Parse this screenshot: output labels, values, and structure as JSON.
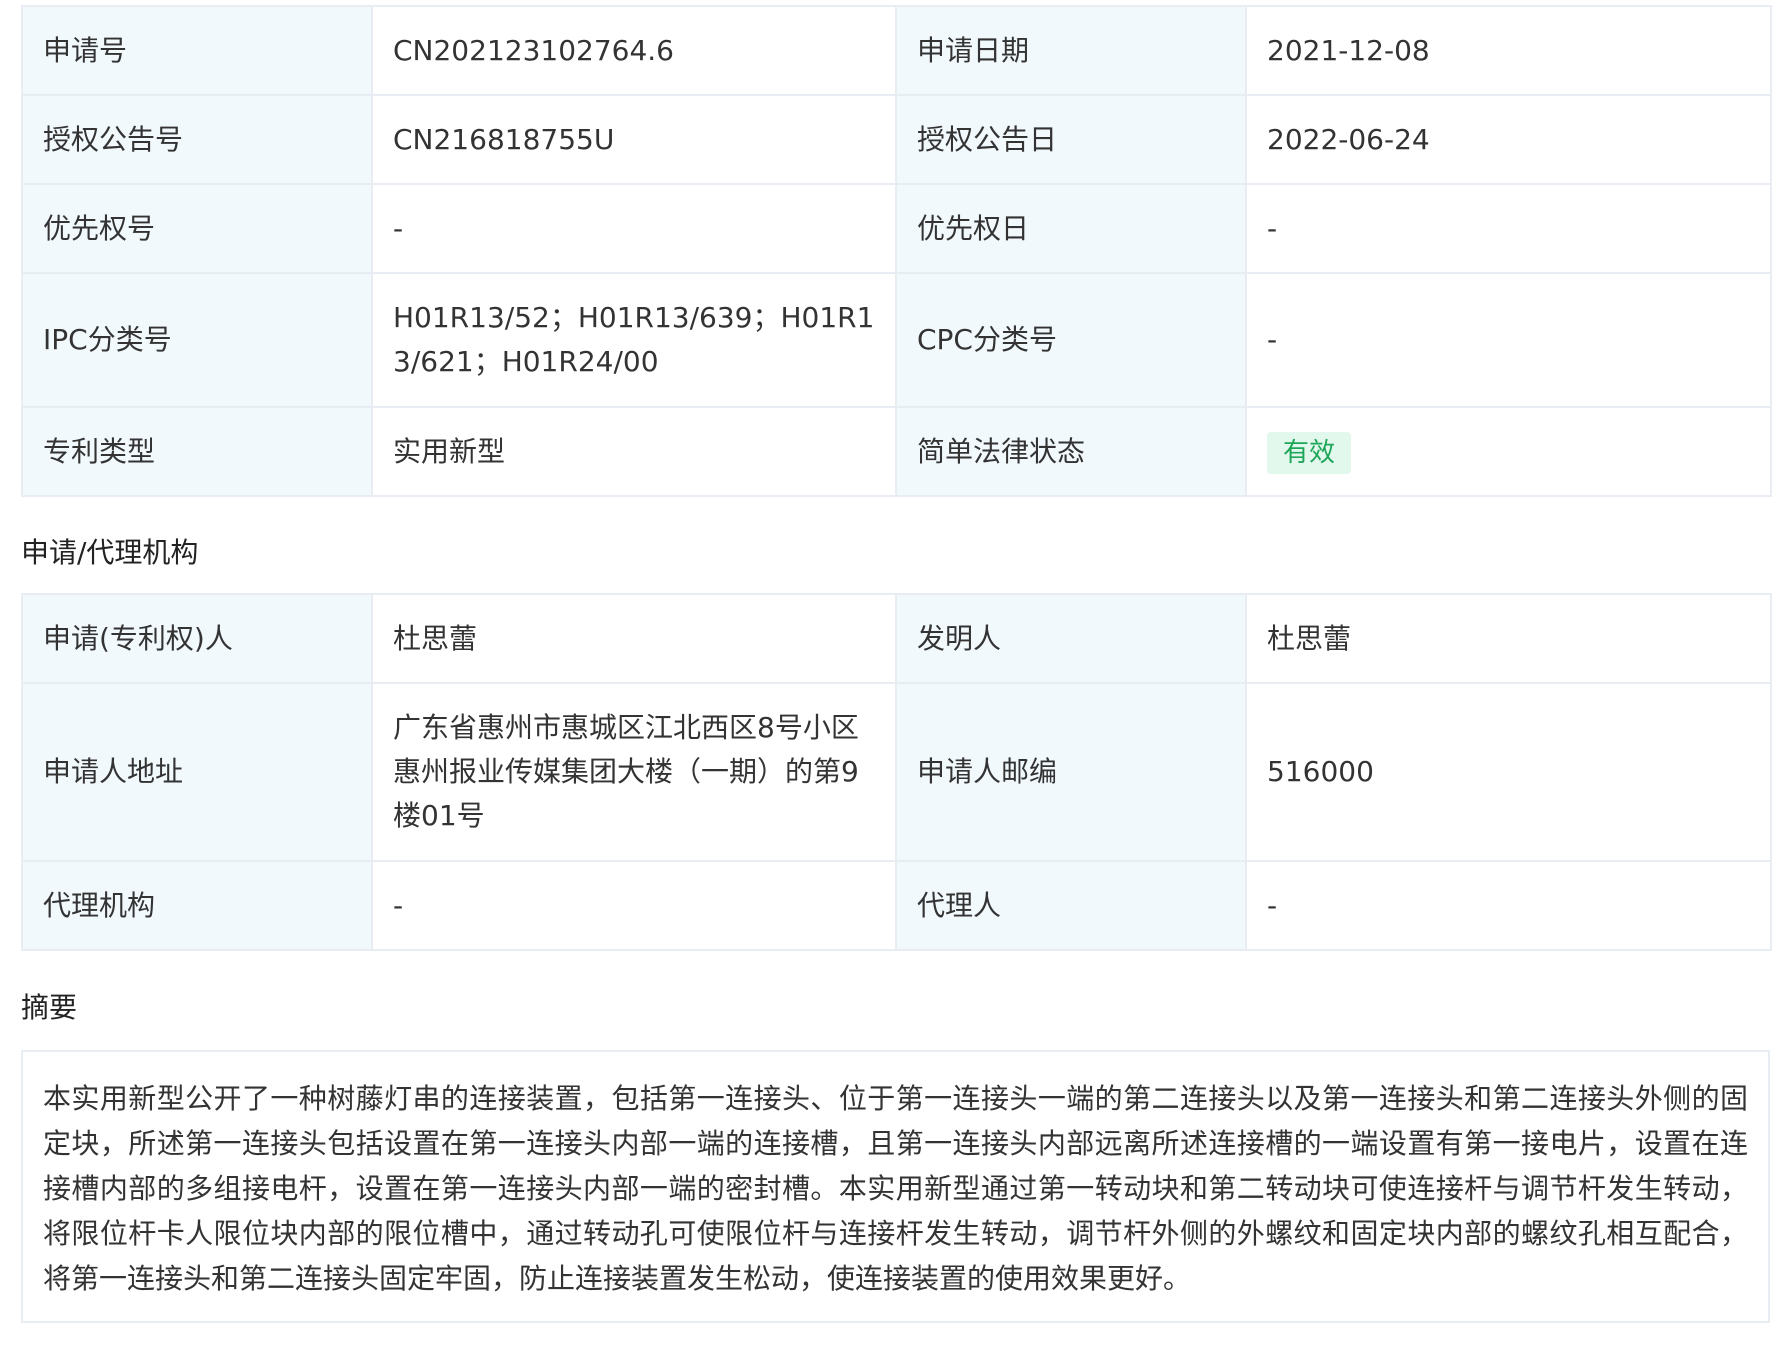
{
  "basic_info": {
    "rows": [
      {
        "k1": "申请号",
        "v1": "CN202123102764.6",
        "k2": "申请日期",
        "v2": "2021-12-08"
      },
      {
        "k1": "授权公告号",
        "v1": "CN216818755U",
        "k2": "授权公告日",
        "v2": "2022-06-24"
      },
      {
        "k1": "优先权号",
        "v1": "-",
        "k2": "优先权日",
        "v2": "-"
      },
      {
        "k1": "IPC分类号",
        "v1": "H01R13/52；H01R13/639；H01R13/621；H01R24/00",
        "k2": "CPC分类号",
        "v2": "-"
      },
      {
        "k1": "专利类型",
        "v1": "实用新型",
        "k2": "简单法律状态",
        "v2": "有效"
      }
    ]
  },
  "agency_section": {
    "title": "申请/代理机构",
    "rows": [
      {
        "k1": "申请(专利权)人",
        "v1": "杜思蕾",
        "k2": "发明人",
        "v2": "杜思蕾"
      },
      {
        "k1": "申请人地址",
        "v1": "广东省惠州市惠城区江北西区8号小区惠州报业传媒集团大楼（一期）的第9楼01号",
        "k2": "申请人邮编",
        "v2": "516000"
      },
      {
        "k1": "代理机构",
        "v1": "-",
        "k2": "代理人",
        "v2": "-"
      }
    ]
  },
  "abstract_section": {
    "title": "摘要",
    "text": "本实用新型公开了一种树藤灯串的连接装置，包括第一连接头、位于第一连接头一端的第二连接头以及第一连接头和第二连接头外侧的固定块，所述第一连接头包括设置在第一连接头内部一端的连接槽，且第一连接头内部远离所述连接槽的一端设置有第一接电片，设置在连接槽内部的多组接电杆，设置在第一连接头内部一端的密封槽。本实用新型通过第一转动块和第二转动块可使连接杆与调节杆发生转动，将限位杆卡人限位块内部的限位槽中，通过转动孔可使限位杆与连接杆发生转动，调节杆外侧的外螺纹和固定块内部的螺纹孔相互配合，将第一连接头和第二连接头固定牢固，防止连接装置发生松动，使连接装置的使用效果更好。"
  },
  "colors": {
    "key_cell_bg": "#f2f9fd",
    "border": "#e8edf3",
    "status_badge_bg": "#e3f8ec",
    "status_badge_text": "#1ea659"
  }
}
